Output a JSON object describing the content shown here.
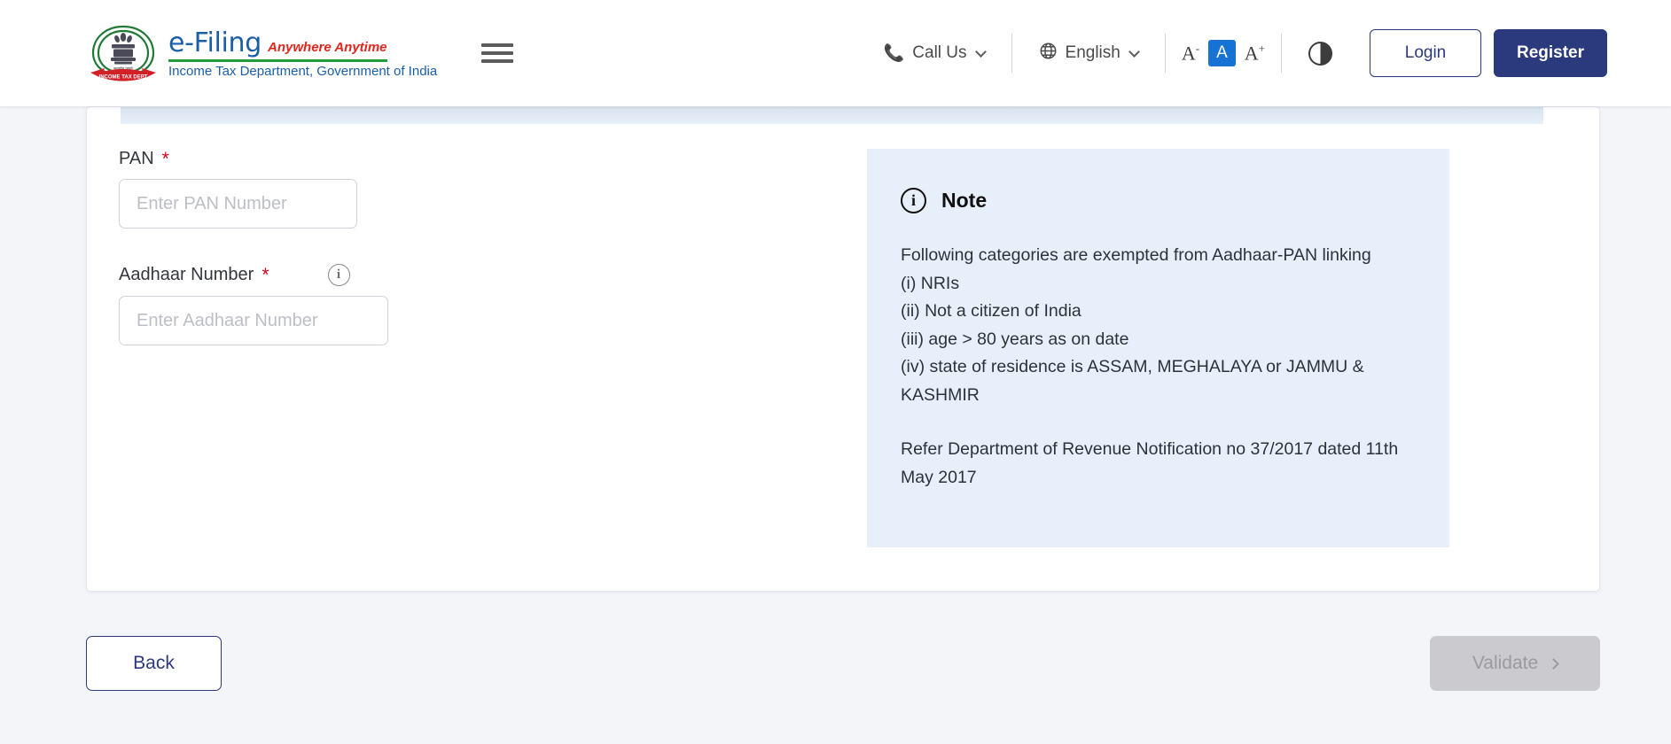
{
  "header": {
    "logo": {
      "emblem_alt": "national-emblem-income-tax-department",
      "title": "e-Filing",
      "tagline": "Anywhere Anytime",
      "department": "Income Tax Department, Government of India"
    },
    "menu_icon": "hamburger-menu-icon",
    "call_us": {
      "label": "Call Us",
      "icon": "phone-icon",
      "chevron": "chevron-down-icon"
    },
    "language": {
      "label": "English",
      "icon": "globe-icon",
      "chevron": "chevron-down-icon"
    },
    "font_size": {
      "decrease": "A",
      "decrease_sup": "-",
      "normal": "A",
      "increase": "A",
      "increase_sup": "+",
      "active": "normal",
      "active_color": "#1673d3"
    },
    "contrast_icon": "contrast-toggle-icon",
    "login_label": "Login",
    "register_label": "Register",
    "register_bg": "#2b3a7c"
  },
  "form": {
    "pan": {
      "label": "PAN",
      "required_mark": "*",
      "placeholder": "Enter PAN Number",
      "value": ""
    },
    "aadhaar": {
      "label": "Aadhaar Number",
      "required_mark": "*",
      "info_icon": "info-circle-icon",
      "placeholder": "Enter Aadhaar Number",
      "value": ""
    },
    "required_color": "#d0021b"
  },
  "note": {
    "icon": "info-circle-icon",
    "title": "Note",
    "bg_color": "#e7f0fa",
    "paragraph1": "Following categories are exempted from Aadhaar-PAN linking\n(i) NRIs\n(ii) Not a citizen of India\n(iii) age > 80 years as on date\n(iv) state of residence is ASSAM, MEGHALAYA or JAMMU & KASHMIR",
    "paragraph2": "Refer Department of Revenue Notification no 37/2017 dated 11th May 2017"
  },
  "footer": {
    "back_label": "Back",
    "validate_label": "Validate",
    "validate_chevron": "chevron-right-icon",
    "validate_disabled": true
  }
}
